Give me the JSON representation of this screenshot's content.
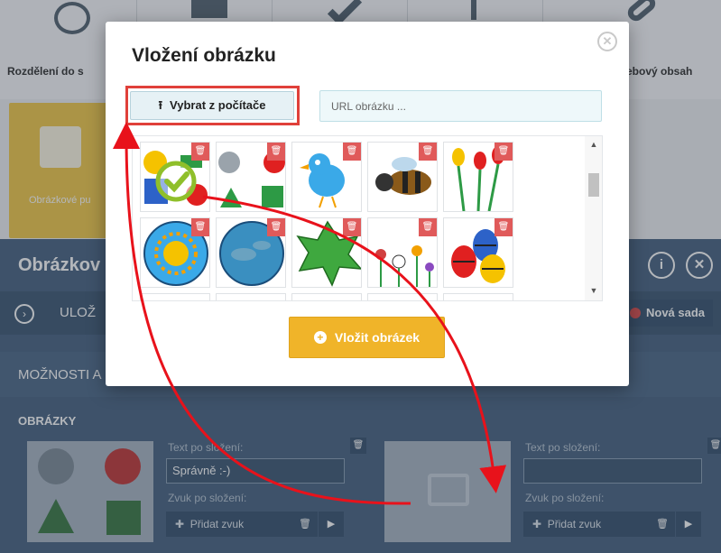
{
  "background": {
    "tiles": [
      {
        "label": "Rozdělení do s",
        "icon": "people-icon"
      },
      {
        "label": "",
        "icon": "puzzle-icon"
      },
      {
        "label": "",
        "icon": "check-icon"
      },
      {
        "label": "",
        "icon": "column-icon"
      },
      {
        "label": "ebový obsah",
        "icon": "link-icon"
      }
    ],
    "puzzle_tile_label": "Obrázkové pu",
    "editor_title": "Obrázkov",
    "info_icon": "info-icon",
    "close_icon": "close-icon",
    "save_label": "ULOŽ",
    "new_set_label": "Nová sada",
    "options_label": "MOŽNOSTI A",
    "images_label": "OBRÁZKY",
    "card1": {
      "text_label": "Text po složení:",
      "text_value": "Správně :-)",
      "sound_label": "Zvuk po složení:",
      "add_sound": "Přidat zvuk"
    },
    "card2": {
      "text_label": "Text po složení:",
      "text_value": "",
      "sound_label": "Zvuk po složení:",
      "add_sound": "Přidat zvuk"
    }
  },
  "modal": {
    "title": "Vložení obrázku",
    "upload_label": "Vybrat z počítače",
    "url_placeholder": "URL obrázku ...",
    "insert_label": "Vložit obrázek",
    "images": [
      {
        "name": "shapes-image",
        "selected": true
      },
      {
        "name": "shapes2-image",
        "selected": false
      },
      {
        "name": "bird-image",
        "selected": false
      },
      {
        "name": "bee-image",
        "selected": false
      },
      {
        "name": "tulips-image",
        "selected": false
      },
      {
        "name": "sun-image",
        "selected": false
      },
      {
        "name": "earth-image",
        "selected": false
      },
      {
        "name": "leaf-image",
        "selected": false
      },
      {
        "name": "flowers-image",
        "selected": false
      },
      {
        "name": "easter-eggs-image",
        "selected": false
      }
    ]
  },
  "colors": {
    "accent_yellow": "#f0b429",
    "highlight_red": "#e0403a",
    "delete_red": "#e05a5a",
    "editor_blue": "#4a6583"
  }
}
